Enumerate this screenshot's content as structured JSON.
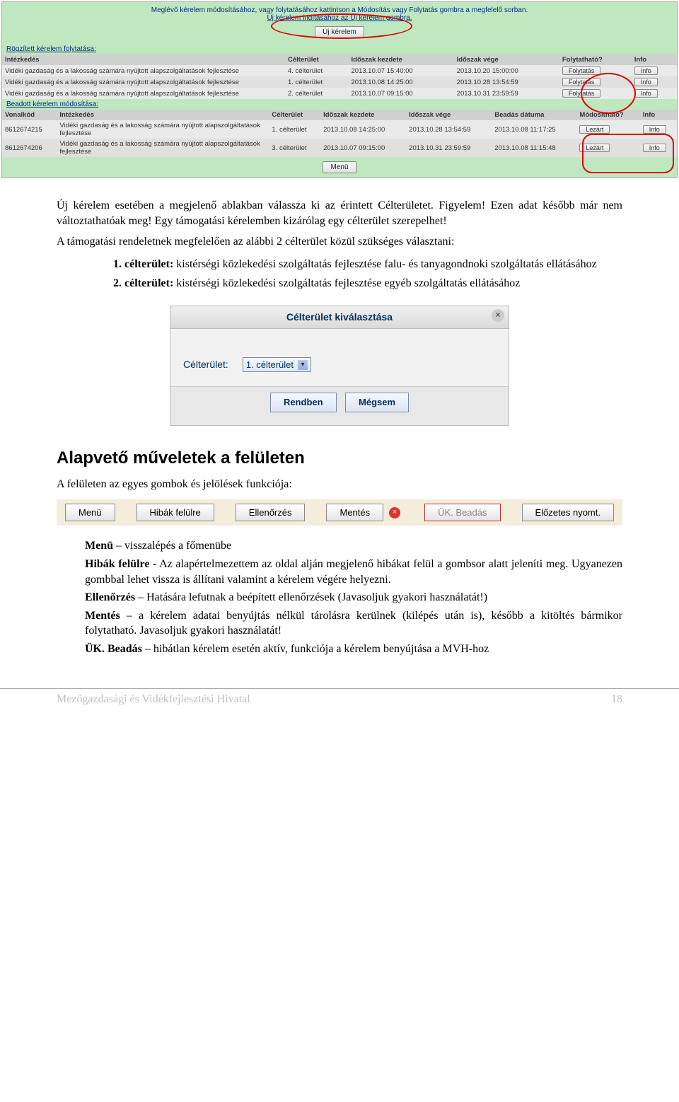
{
  "top": {
    "instr_line1": "Meglévő kérelem módosításához, vagy folytatásához kattintson a Módosítás vagy Folytatás gombra a megfelelő sorban.",
    "instr_line2": "Új kérelem indításához az Új kérelem gombra.",
    "uj_kerelem_btn": "Új kérelem"
  },
  "sec1": {
    "title": "Rögzített kérelem folytatása:",
    "headers": {
      "intezkedes": "Intézkedés",
      "celterulet": "Célterület",
      "kezd": "Időszak kezdete",
      "veg": "Időszak vége",
      "foly": "Folytatható?",
      "info": "Info"
    },
    "rows": [
      {
        "intezkedes": "Vidéki gazdaság és a lakosság számára nyújtott alapszolgáltatások fejlesztése",
        "cel": "4. célterület",
        "kezd": "2013.10.07 15:40:00",
        "veg": "2013.10.20 15:00:00",
        "btn": "Folytatás",
        "info": "Info"
      },
      {
        "intezkedes": "Vidéki gazdaság és a lakosság számára nyújtott alapszolgáltatások fejlesztése",
        "cel": "1. célterület",
        "kezd": "2013.10.08 14:25:00",
        "veg": "2013.10.28 13:54:59",
        "btn": "Folytatás",
        "info": "Info"
      },
      {
        "intezkedes": "Vidéki gazdaság és a lakosság számára nyújtott alapszolgáltatások fejlesztése",
        "cel": "2. célterület",
        "kezd": "2013.10.07 09:15:00",
        "veg": "2013.10.31 23:59:59",
        "btn": "Folytatás",
        "info": "Info"
      }
    ]
  },
  "sec2": {
    "title": "Beadott kérelem módosítása:",
    "headers": {
      "vonalkod": "Vonalkód",
      "intezkedes": "Intézkedés",
      "celterulet": "Célterület",
      "kezd": "Időszak kezdete",
      "veg": "Időszak vége",
      "beadas": "Beadás dátuma",
      "mod": "Módosítható?",
      "info": "Info"
    },
    "rows": [
      {
        "vonalkod": "8612674215",
        "intezkedes": "Vidéki gazdaság és a lakosság számára nyújtott alapszolgáltatások fejlesztése",
        "cel": "1. célterület",
        "kezd": "2013.10.08 14:25:00",
        "veg": "2013.10.28 13:54:59",
        "beadas": "2013.10.08 11:17:25",
        "mod": "Lezárt",
        "info": "Info"
      },
      {
        "vonalkod": "8612674206",
        "intezkedes": "Vidéki gazdaság és a lakosság számára nyújtott alapszolgáltatások fejlesztése",
        "cel": "3. célterület",
        "kezd": "2013.10.07 09:15:00",
        "veg": "2013.10.31 23:59:59",
        "beadas": "2013.10.08 11:15:48",
        "mod": "Lezárt",
        "info": "Info"
      }
    ],
    "menu_btn": "Menü"
  },
  "para": {
    "p1": "Új kérelem esetében a megjelenő ablakban válassza ki az érintett Célterületet. Figyelem! Ezen adat később már nem változtathatóak meg! Egy támogatási kérelemben kizárólag egy célterület szerepelhet!",
    "p2": "A támogatási rendeletnek megfelelően az alábbi 2 célterület közül szükséges választani:",
    "c1_label": "1. célterület:",
    "c1_text": "kistérségi közlekedési szolgáltatás fejlesztése falu- és tanyagondnoki szolgáltatás ellátásához",
    "c2_label": "2. célterület:",
    "c2_text": "kistérségi közlekedési szolgáltatás fejlesztése egyéb szolgáltatás ellátásához"
  },
  "modal": {
    "title": "Célterület kiválasztása",
    "label": "Célterület:",
    "selected": "1. célterület",
    "ok": "Rendben",
    "cancel": "Mégsem"
  },
  "ops": {
    "heading": "Alapvető műveletek a felületen",
    "intro": "A felületen az egyes gombok és jelölések funkciója:",
    "buttons": {
      "menu": "Menü",
      "hibak": "Hibák felülre",
      "ellen": "Ellenőrzés",
      "mentes": "Mentés",
      "ukbeadas": "ÜK. Beadás",
      "elozetes": "Előzetes nyomt."
    }
  },
  "defs": {
    "menu_term": "Menü",
    "menu_text": " – visszalépés a főmenübe",
    "hibak_term": "Hibák felülre -",
    "hibak_text": " Az alapértelmezettem az oldal alján megjelenő hibákat felül a gombsor alatt jeleníti meg. Ugyanezen gombbal lehet vissza is állítani valamint a kérelem végére helyezni.",
    "ellen_term": "Ellenőrzés",
    "ellen_text": " – Hatására lefutnak a beépített ellenőrzések (Javasoljuk gyakori használatát!)",
    "mentes_term": "Mentés",
    "mentes_text": " – a kérelem adatai benyújtás nélkül tárolásra kerülnek (kilépés után is), később a kitöltés bármikor folytatható. Javasoljuk gyakori használatát!",
    "uk_term": "ÜK. Beadás",
    "uk_text": " – hibátlan kérelem esetén aktív, funkciója a kérelem benyújtása a MVH-hoz"
  },
  "footer": {
    "org": "Mezőgazdasági és Vidékfejlesztési Hivatal",
    "page": "18"
  }
}
